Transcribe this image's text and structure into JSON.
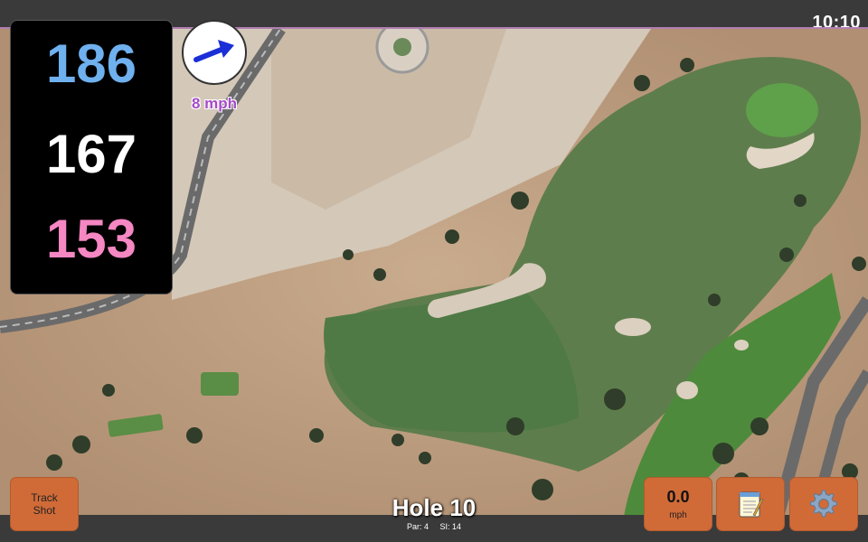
{
  "status": {
    "time": "10:10"
  },
  "distances": {
    "back": "186",
    "middle": "167",
    "front": "153"
  },
  "wind": {
    "label": "8 mph",
    "icon": "wind-direction-arrow-icon",
    "arrow_color": "#1a2fd6"
  },
  "buttons": {
    "track_shot": {
      "line1": "Track",
      "line2": "Shot"
    },
    "wind_speed": {
      "value": "0.0",
      "unit": "mph"
    },
    "notes": {
      "icon": "notepad-icon"
    },
    "settings": {
      "icon": "gear-icon"
    }
  },
  "hole": {
    "title": "Hole 10",
    "par": "Par: 4",
    "si": "SI: 14"
  },
  "colors": {
    "back_distance": "#6fb0ef",
    "middle_distance": "#ffffff",
    "front_distance": "#f587c3",
    "button": "#d06b38",
    "wind_label": "#a64ac9"
  }
}
